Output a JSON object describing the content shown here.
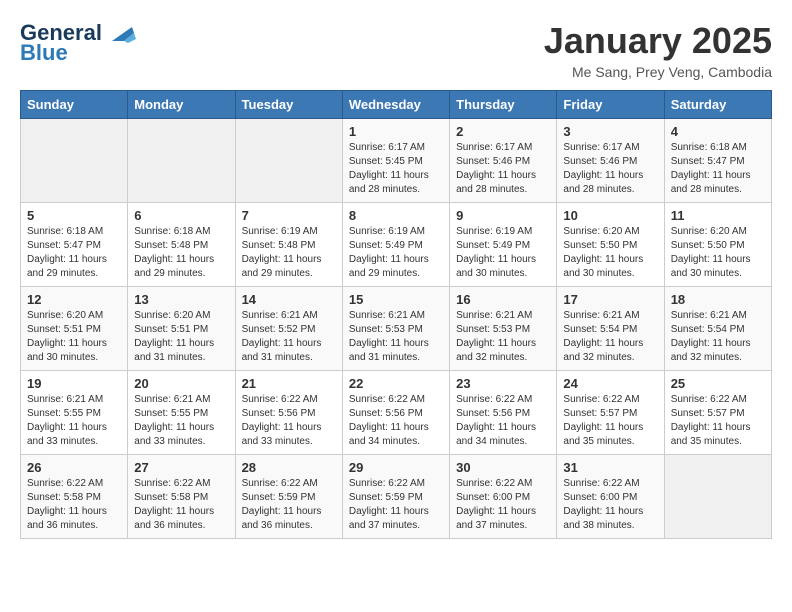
{
  "header": {
    "logo_line1": "General",
    "logo_line2": "Blue",
    "title": "January 2025",
    "subtitle": "Me Sang, Prey Veng, Cambodia"
  },
  "weekdays": [
    "Sunday",
    "Monday",
    "Tuesday",
    "Wednesday",
    "Thursday",
    "Friday",
    "Saturday"
  ],
  "weeks": [
    [
      {
        "day": "",
        "sunrise": "",
        "sunset": "",
        "daylight": ""
      },
      {
        "day": "",
        "sunrise": "",
        "sunset": "",
        "daylight": ""
      },
      {
        "day": "",
        "sunrise": "",
        "sunset": "",
        "daylight": ""
      },
      {
        "day": "1",
        "sunrise": "Sunrise: 6:17 AM",
        "sunset": "Sunset: 5:45 PM",
        "daylight": "Daylight: 11 hours and 28 minutes."
      },
      {
        "day": "2",
        "sunrise": "Sunrise: 6:17 AM",
        "sunset": "Sunset: 5:46 PM",
        "daylight": "Daylight: 11 hours and 28 minutes."
      },
      {
        "day": "3",
        "sunrise": "Sunrise: 6:17 AM",
        "sunset": "Sunset: 5:46 PM",
        "daylight": "Daylight: 11 hours and 28 minutes."
      },
      {
        "day": "4",
        "sunrise": "Sunrise: 6:18 AM",
        "sunset": "Sunset: 5:47 PM",
        "daylight": "Daylight: 11 hours and 28 minutes."
      }
    ],
    [
      {
        "day": "5",
        "sunrise": "Sunrise: 6:18 AM",
        "sunset": "Sunset: 5:47 PM",
        "daylight": "Daylight: 11 hours and 29 minutes."
      },
      {
        "day": "6",
        "sunrise": "Sunrise: 6:18 AM",
        "sunset": "Sunset: 5:48 PM",
        "daylight": "Daylight: 11 hours and 29 minutes."
      },
      {
        "day": "7",
        "sunrise": "Sunrise: 6:19 AM",
        "sunset": "Sunset: 5:48 PM",
        "daylight": "Daylight: 11 hours and 29 minutes."
      },
      {
        "day": "8",
        "sunrise": "Sunrise: 6:19 AM",
        "sunset": "Sunset: 5:49 PM",
        "daylight": "Daylight: 11 hours and 29 minutes."
      },
      {
        "day": "9",
        "sunrise": "Sunrise: 6:19 AM",
        "sunset": "Sunset: 5:49 PM",
        "daylight": "Daylight: 11 hours and 30 minutes."
      },
      {
        "day": "10",
        "sunrise": "Sunrise: 6:20 AM",
        "sunset": "Sunset: 5:50 PM",
        "daylight": "Daylight: 11 hours and 30 minutes."
      },
      {
        "day": "11",
        "sunrise": "Sunrise: 6:20 AM",
        "sunset": "Sunset: 5:50 PM",
        "daylight": "Daylight: 11 hours and 30 minutes."
      }
    ],
    [
      {
        "day": "12",
        "sunrise": "Sunrise: 6:20 AM",
        "sunset": "Sunset: 5:51 PM",
        "daylight": "Daylight: 11 hours and 30 minutes."
      },
      {
        "day": "13",
        "sunrise": "Sunrise: 6:20 AM",
        "sunset": "Sunset: 5:51 PM",
        "daylight": "Daylight: 11 hours and 31 minutes."
      },
      {
        "day": "14",
        "sunrise": "Sunrise: 6:21 AM",
        "sunset": "Sunset: 5:52 PM",
        "daylight": "Daylight: 11 hours and 31 minutes."
      },
      {
        "day": "15",
        "sunrise": "Sunrise: 6:21 AM",
        "sunset": "Sunset: 5:53 PM",
        "daylight": "Daylight: 11 hours and 31 minutes."
      },
      {
        "day": "16",
        "sunrise": "Sunrise: 6:21 AM",
        "sunset": "Sunset: 5:53 PM",
        "daylight": "Daylight: 11 hours and 32 minutes."
      },
      {
        "day": "17",
        "sunrise": "Sunrise: 6:21 AM",
        "sunset": "Sunset: 5:54 PM",
        "daylight": "Daylight: 11 hours and 32 minutes."
      },
      {
        "day": "18",
        "sunrise": "Sunrise: 6:21 AM",
        "sunset": "Sunset: 5:54 PM",
        "daylight": "Daylight: 11 hours and 32 minutes."
      }
    ],
    [
      {
        "day": "19",
        "sunrise": "Sunrise: 6:21 AM",
        "sunset": "Sunset: 5:55 PM",
        "daylight": "Daylight: 11 hours and 33 minutes."
      },
      {
        "day": "20",
        "sunrise": "Sunrise: 6:21 AM",
        "sunset": "Sunset: 5:55 PM",
        "daylight": "Daylight: 11 hours and 33 minutes."
      },
      {
        "day": "21",
        "sunrise": "Sunrise: 6:22 AM",
        "sunset": "Sunset: 5:56 PM",
        "daylight": "Daylight: 11 hours and 33 minutes."
      },
      {
        "day": "22",
        "sunrise": "Sunrise: 6:22 AM",
        "sunset": "Sunset: 5:56 PM",
        "daylight": "Daylight: 11 hours and 34 minutes."
      },
      {
        "day": "23",
        "sunrise": "Sunrise: 6:22 AM",
        "sunset": "Sunset: 5:56 PM",
        "daylight": "Daylight: 11 hours and 34 minutes."
      },
      {
        "day": "24",
        "sunrise": "Sunrise: 6:22 AM",
        "sunset": "Sunset: 5:57 PM",
        "daylight": "Daylight: 11 hours and 35 minutes."
      },
      {
        "day": "25",
        "sunrise": "Sunrise: 6:22 AM",
        "sunset": "Sunset: 5:57 PM",
        "daylight": "Daylight: 11 hours and 35 minutes."
      }
    ],
    [
      {
        "day": "26",
        "sunrise": "Sunrise: 6:22 AM",
        "sunset": "Sunset: 5:58 PM",
        "daylight": "Daylight: 11 hours and 36 minutes."
      },
      {
        "day": "27",
        "sunrise": "Sunrise: 6:22 AM",
        "sunset": "Sunset: 5:58 PM",
        "daylight": "Daylight: 11 hours and 36 minutes."
      },
      {
        "day": "28",
        "sunrise": "Sunrise: 6:22 AM",
        "sunset": "Sunset: 5:59 PM",
        "daylight": "Daylight: 11 hours and 36 minutes."
      },
      {
        "day": "29",
        "sunrise": "Sunrise: 6:22 AM",
        "sunset": "Sunset: 5:59 PM",
        "daylight": "Daylight: 11 hours and 37 minutes."
      },
      {
        "day": "30",
        "sunrise": "Sunrise: 6:22 AM",
        "sunset": "Sunset: 6:00 PM",
        "daylight": "Daylight: 11 hours and 37 minutes."
      },
      {
        "day": "31",
        "sunrise": "Sunrise: 6:22 AM",
        "sunset": "Sunset: 6:00 PM",
        "daylight": "Daylight: 11 hours and 38 minutes."
      },
      {
        "day": "",
        "sunrise": "",
        "sunset": "",
        "daylight": ""
      }
    ]
  ]
}
